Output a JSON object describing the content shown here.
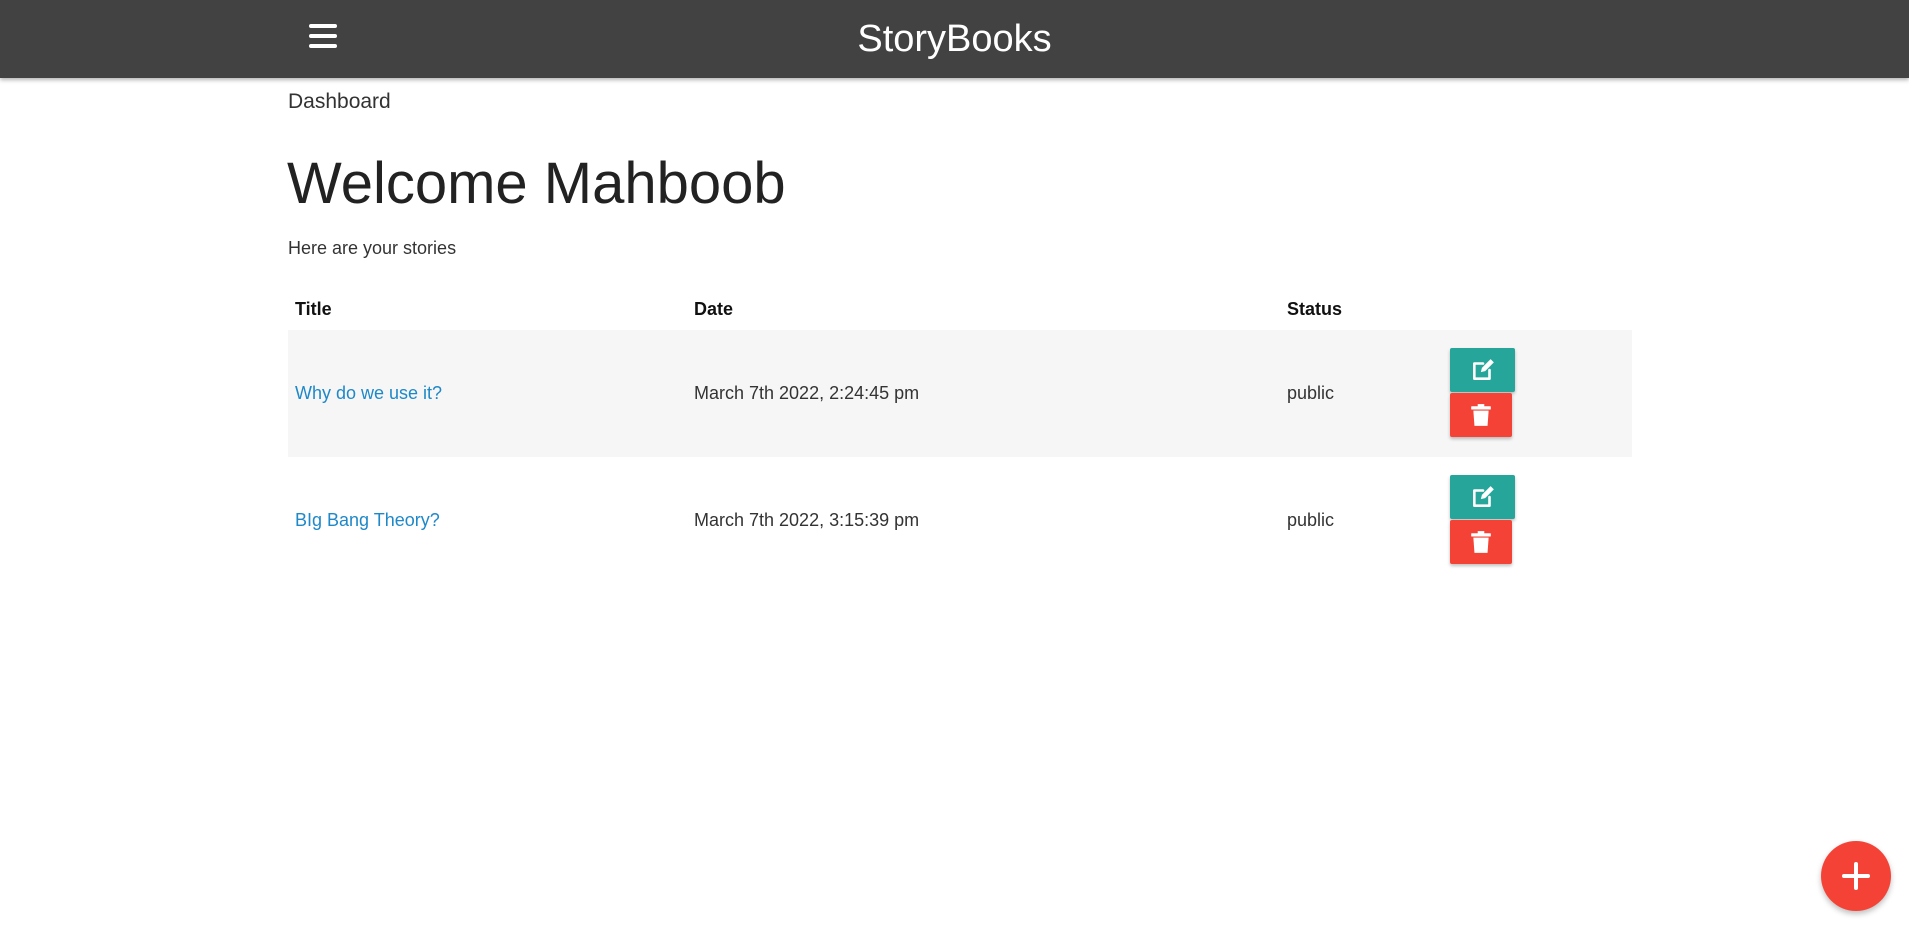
{
  "app": {
    "brand": "StoryBooks",
    "menu_icon": "hamburger-menu-icon"
  },
  "page": {
    "breadcrumb": "Dashboard",
    "heading": "Welcome Mahboob",
    "subtitle": "Here are your stories"
  },
  "table": {
    "headers": [
      "Title",
      "Date",
      "Status",
      ""
    ],
    "rows": [
      {
        "title": "Why do we use it?",
        "date": "March 7th 2022, 2:24:45 pm",
        "status": "public"
      },
      {
        "title": "BIg Bang Theory?",
        "date": "March 7th 2022, 3:15:39 pm",
        "status": "public"
      }
    ],
    "row_actions": {
      "edit_icon": "edit-icon",
      "delete_icon": "trash-icon"
    }
  },
  "fab": {
    "icon": "plus-icon"
  },
  "colors": {
    "navbar": "#424242",
    "link": "#1e88c8",
    "edit_button": "#26a69a",
    "delete_button": "#f44336",
    "fab": "#f44336",
    "striped_row": "#f6f6f6"
  }
}
